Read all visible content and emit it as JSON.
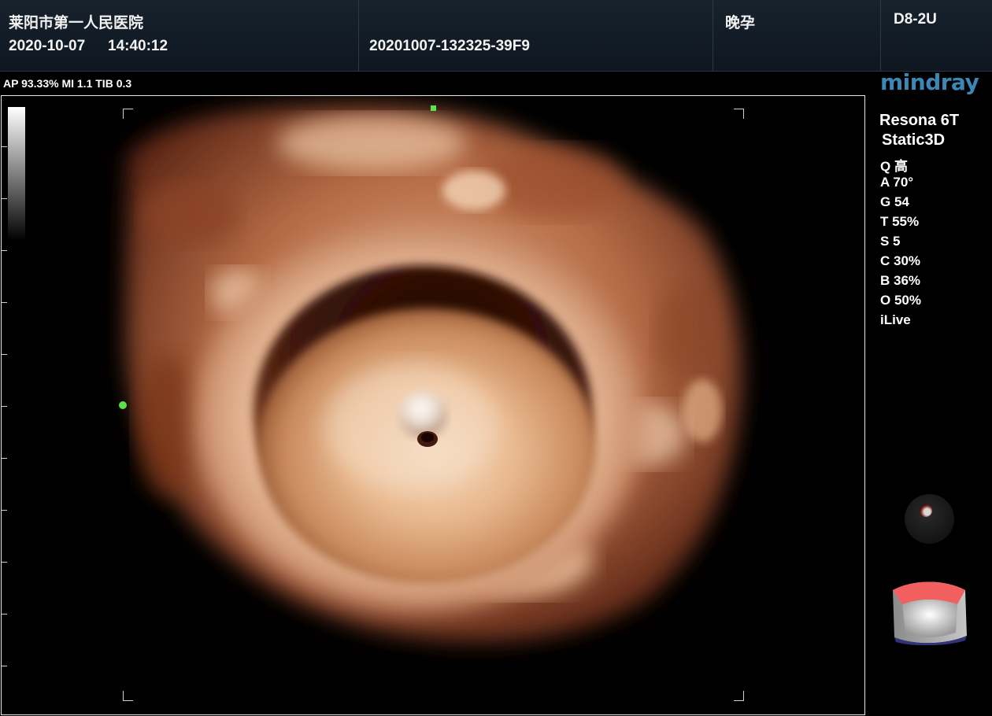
{
  "header": {
    "hospital": "莱阳市第一人民医院",
    "date": "2020-10-07",
    "time": "14:40:12",
    "exam_id": "20201007-132325-39F9",
    "exam_type": "晚孕",
    "probe": "D8-2U"
  },
  "acoustic_output": "AP 93.33%  MI 1.1 TIB 0.3",
  "brand_logo": "mindray",
  "params": {
    "model": "Resona 6T",
    "mode": "Static3D",
    "items": [
      "Q 高",
      "A 70°",
      "G 54",
      "T 55%",
      "S 5",
      "C 30%",
      "B 36%",
      "O 50%",
      "iLive"
    ]
  },
  "colors": {
    "marker": "#5fe04a",
    "logo": "#3b87b6",
    "orientation_top": "#f25f5f",
    "orientation_bottom": "#33337a"
  },
  "icons": {
    "knob": "trackball-icon",
    "orientation": "3d-orientation-cube-icon"
  }
}
